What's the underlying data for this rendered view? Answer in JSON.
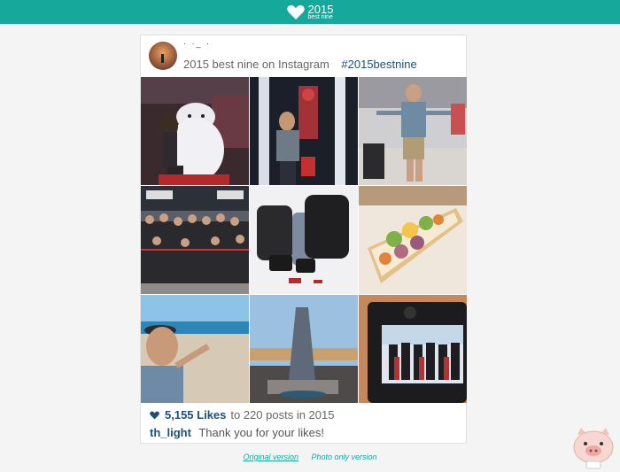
{
  "header": {
    "brand_year": "2015",
    "brand_sub": "best nine",
    "bar_color": "#16a89a"
  },
  "card": {
    "username": "",
    "caption": "2015 best nine on Instagram",
    "hashtag": "#2015bestnine",
    "likes_count": "5,155 Likes",
    "likes_rest": "to 220 posts in 2015",
    "comment_user": "th_light",
    "comment_text": "Thank you for your likes!"
  },
  "photos": [
    "baymax-photo",
    "iron-man-photo",
    "airport-photo",
    "group-photo",
    "backpacks-photo",
    "fruit-tart-photo",
    "beach-selfie-photo",
    "sculpture-photo",
    "graduation-camera-photo"
  ],
  "footer": {
    "original_label": "Original version",
    "photo_only_label": "Photo only version"
  },
  "colors": {
    "accent": "#16a89a",
    "link": "#1e4f7a"
  }
}
